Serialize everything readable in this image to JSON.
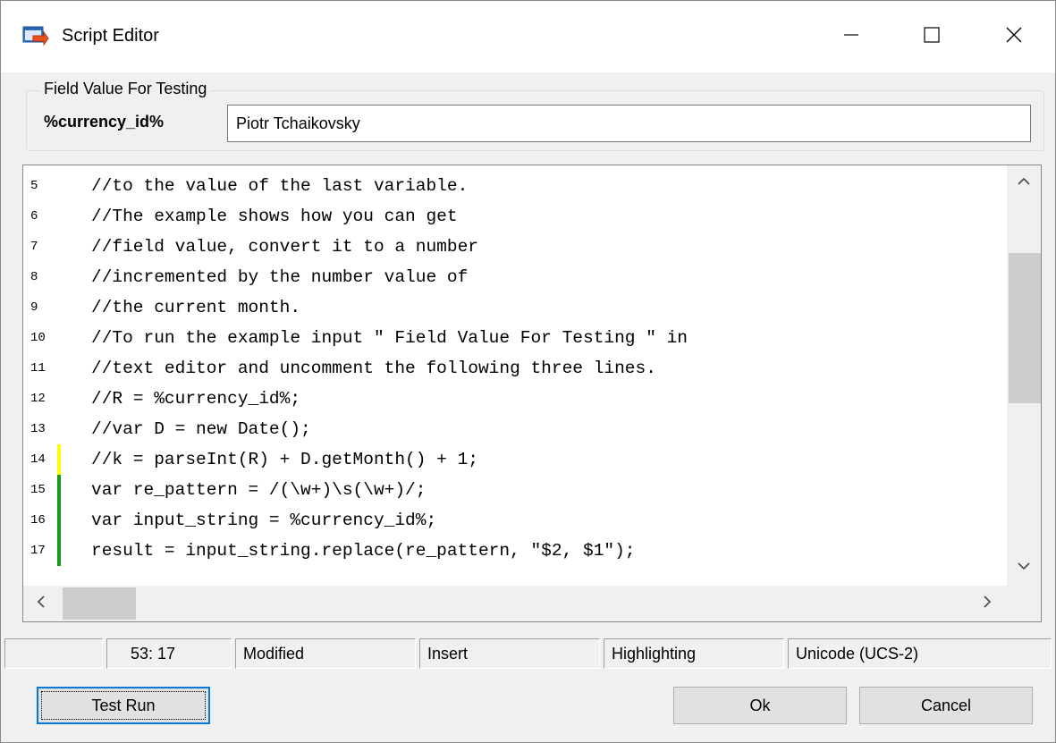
{
  "window": {
    "title": "Script Editor",
    "icon": "script-editor-app-icon",
    "controls": [
      "minimize-icon",
      "maximize-icon",
      "close-icon"
    ]
  },
  "field_group": {
    "legend": "Field Value For Testing",
    "field_label": "%currency_id%",
    "field_value": "Piotr Tchaikovsky"
  },
  "editor": {
    "lines": [
      {
        "number": "5",
        "text": "//to the value of the last variable.",
        "marker": ""
      },
      {
        "number": "6",
        "text": "//The example shows how you can get",
        "marker": ""
      },
      {
        "number": "7",
        "text": "//field value, convert it to a number",
        "marker": ""
      },
      {
        "number": "8",
        "text": "//incremented by the number value of",
        "marker": ""
      },
      {
        "number": "9",
        "text": "//the current month.",
        "marker": ""
      },
      {
        "number": "10",
        "text": "//To run the example input \" Field Value For Testing \" in",
        "marker": ""
      },
      {
        "number": "11",
        "text": "//text editor and uncomment the following three lines.",
        "marker": ""
      },
      {
        "number": "12",
        "text": "//R = %currency_id%;",
        "marker": ""
      },
      {
        "number": "13",
        "text": "//var D = new Date();",
        "marker": ""
      },
      {
        "number": "14",
        "text": "//k = parseInt(R) + D.getMonth() + 1;",
        "marker": "yellow"
      },
      {
        "number": "15",
        "text": "var re_pattern = /(\\w+)\\s(\\w+)/;",
        "marker": "green"
      },
      {
        "number": "16",
        "text": "var input_string = %currency_id%;",
        "marker": "green"
      },
      {
        "number": "17",
        "text": "result = input_string.replace(re_pattern, \"$2, $1\");",
        "marker": "green"
      }
    ],
    "scroll_icons": [
      "chevron-up-icon",
      "chevron-down-icon",
      "chevron-left-icon",
      "chevron-right-icon"
    ]
  },
  "status": {
    "position": "53:  17",
    "modified": "Modified",
    "mode": "Insert",
    "highlighting": "Highlighting",
    "encoding": "Unicode (UCS-2)"
  },
  "buttons": {
    "test_run": "Test Run",
    "ok": "Ok",
    "cancel": "Cancel"
  },
  "colors": {
    "modified_marker": "#ffff00",
    "saved_marker": "#1a9a1a",
    "default_button_border": "#0078d7"
  }
}
